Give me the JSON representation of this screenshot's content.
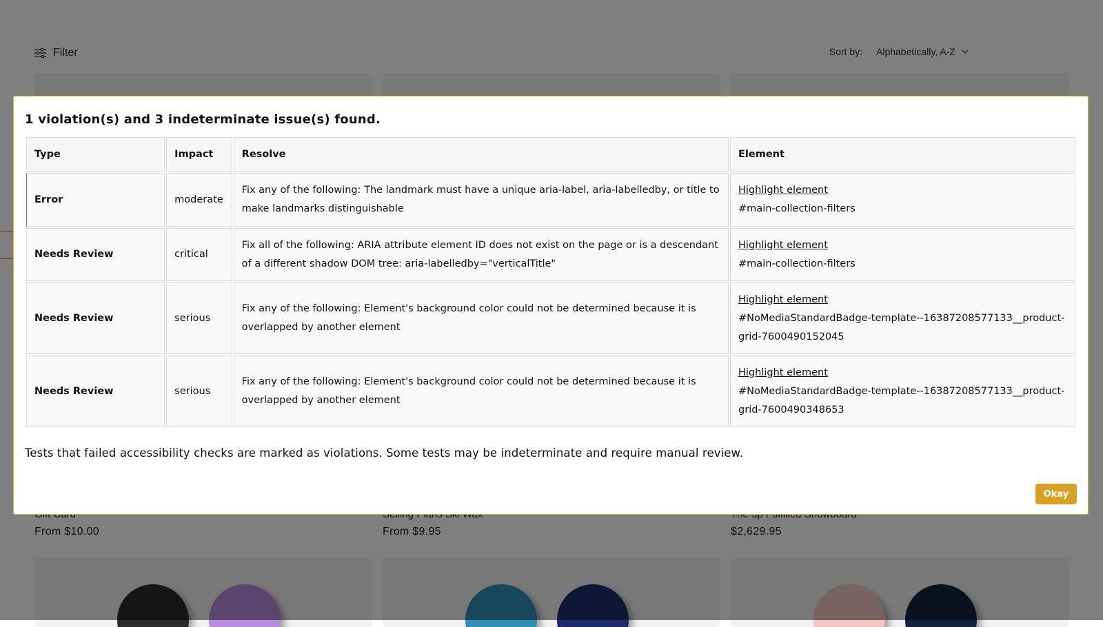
{
  "toolbar": {
    "filter_label": "Filter",
    "sort_label": "Sort by:",
    "sort_value": "Alphabetically, A-Z"
  },
  "products": [
    {
      "title": "Gift Card",
      "price": "From $10.00"
    },
    {
      "title": "Selling Plans Ski Wax",
      "price": "From $9.95"
    },
    {
      "title": "The 3p Fulfilled Snowboard",
      "price": "$2,629.95"
    }
  ],
  "modal": {
    "title": "1 violation(s) and 3 indeterminate issue(s) found.",
    "columns": [
      "Type",
      "Impact",
      "Resolve",
      "Element"
    ],
    "rows": [
      {
        "type": "Error",
        "impact": "moderate",
        "resolve": "Fix any of the following: The landmark must have a unique aria-label, aria-labelledby, or title to make landmarks distinguishable",
        "link": "Highlight element",
        "element": "#main-collection-filters"
      },
      {
        "type": "Needs Review",
        "impact": "critical",
        "resolve": "Fix all of the following: ARIA attribute element ID does not exist on the page or is a descendant of a different shadow DOM tree: aria-labelledby=\"verticalTitle\"",
        "link": "Highlight element",
        "element": "#main-collection-filters"
      },
      {
        "type": "Needs Review",
        "impact": "serious",
        "resolve": "Fix any of the following: Element's background color could not be determined because it is overlapped by another element",
        "link": "Highlight element",
        "element": "#NoMediaStandardBadge-template--16387208577133__product-grid-7600490152045"
      },
      {
        "type": "Needs Review",
        "impact": "serious",
        "resolve": "Fix any of the following: Element's background color could not be determined because it is overlapped by another element",
        "link": "Highlight element",
        "element": "#NoMediaStandardBadge-template--16387208577133__product-grid-7600490348653"
      }
    ],
    "footer": "Tests that failed accessibility checks are marked as violations. Some tests may be indeterminate and require manual review.",
    "okay_label": "Okay"
  },
  "colors": {
    "error": "#e05555",
    "needs_review": "#e0b030",
    "accent": "#d7a224"
  }
}
